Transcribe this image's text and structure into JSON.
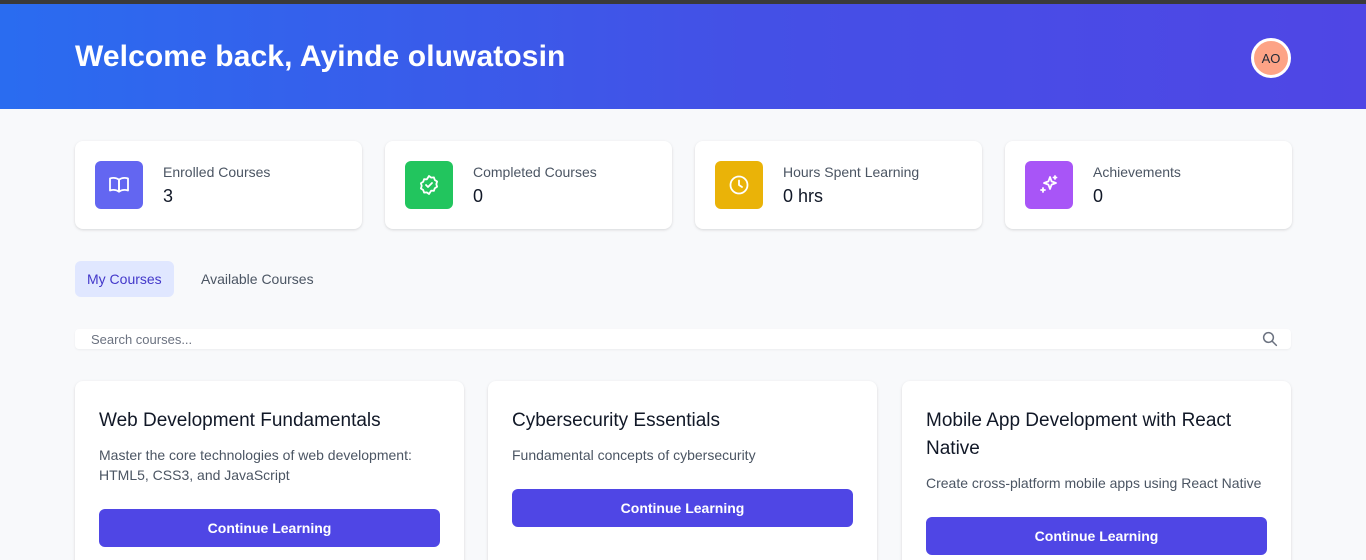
{
  "header": {
    "welcome": "Welcome back, Ayinde oluwatosin",
    "avatar_initials": "AO"
  },
  "stats": [
    {
      "label": "Enrolled Courses",
      "value": "3",
      "icon": "book-open-icon",
      "color": "#6366f1"
    },
    {
      "label": "Completed Courses",
      "value": "0",
      "icon": "badge-check-icon",
      "color": "#22c55e"
    },
    {
      "label": "Hours Spent Learning",
      "value": "0 hrs",
      "icon": "clock-icon",
      "color": "#eab308"
    },
    {
      "label": "Achievements",
      "value": "0",
      "icon": "sparkles-icon",
      "color": "#a855f7"
    }
  ],
  "tabs": [
    {
      "label": "My Courses",
      "active": true
    },
    {
      "label": "Available Courses",
      "active": false
    }
  ],
  "search": {
    "placeholder": "Search courses..."
  },
  "courses": [
    {
      "title": "Web Development Fundamentals",
      "description": "Master the core technologies of web development: HTML5, CSS3, and JavaScript",
      "button": "Continue Learning"
    },
    {
      "title": "Cybersecurity Essentials",
      "description": "Fundamental concepts of cybersecurity",
      "button": "Continue Learning"
    },
    {
      "title": "Mobile App Development with React Native",
      "description": "Create cross-platform mobile apps using React Native",
      "button": "Continue Learning"
    }
  ],
  "colors": {
    "header_start": "#2a6cf0",
    "header_end": "#4f46e5",
    "accent": "#4f46e5",
    "avatar_bg": "#fda386"
  }
}
